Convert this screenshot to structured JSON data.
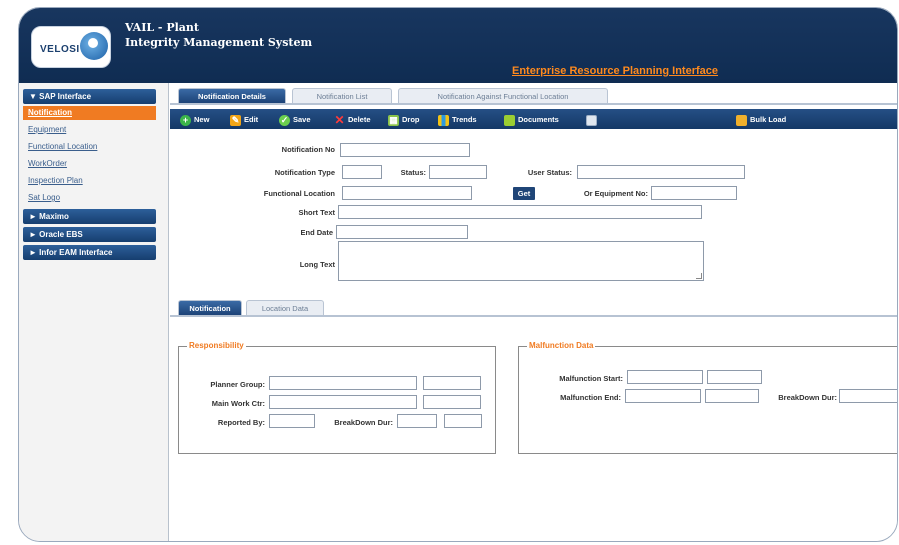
{
  "header": {
    "logo_text": "VELOSI",
    "title_line1": "VAIL - Plant",
    "title_line2": "Integrity Management System",
    "erp_link": "Enterprise Resource Planning Interface"
  },
  "sidebar": {
    "sections": [
      {
        "label": "▼ SAP Interface"
      },
      {
        "label": "► Maximo"
      },
      {
        "label": "► Oracle EBS"
      },
      {
        "label": "► Infor EAM Interface"
      }
    ],
    "sap_items": [
      {
        "label": "Notification",
        "active": true
      },
      {
        "label": "Equipment"
      },
      {
        "label": "Functional Location"
      },
      {
        "label": "WorkOrder"
      },
      {
        "label": "Inspection Plan"
      },
      {
        "label": "Sat Logo"
      }
    ]
  },
  "tabs": [
    {
      "label": "Notification Details",
      "active": true
    },
    {
      "label": "Notification List"
    },
    {
      "label": "Notification Against Functional Location"
    }
  ],
  "toolbar": {
    "new": "New",
    "edit": "Edit",
    "save": "Save",
    "delete": "Delete",
    "drop": "Drop",
    "trends": "Trends",
    "documents": "Documents",
    "bulk_load": "Bulk Load"
  },
  "form": {
    "notification_no": "Notification No",
    "notification_type": "Notification Type",
    "status": "Status:",
    "user_status": "User Status:",
    "functional_location": "Functional Location",
    "get_button": "Get",
    "or_equipment_no": "Or Equipment No:",
    "short_text": "Short Text",
    "end_date": "End Date",
    "long_text": "Long Text"
  },
  "subtabs": [
    {
      "label": "Notification",
      "active": true
    },
    {
      "label": "Location Data"
    }
  ],
  "responsibility": {
    "legend": "Responsibility",
    "planner_group": "Planner Group:",
    "main_work_ctr": "Main Work Ctr:",
    "reported_by": "Reported By:",
    "breakdown_dur": "BreakDown Dur:"
  },
  "malfunction": {
    "legend": "Malfunction Data",
    "malfunction_start": "Malfunction Start:",
    "malfunction_end": "Malfunction End:",
    "breakdown_dur": "BreakDown Dur:"
  },
  "colors": {
    "header_bg": "#143866",
    "accent_orange": "#f07b22",
    "sidebar_head": "#1f4a80"
  }
}
